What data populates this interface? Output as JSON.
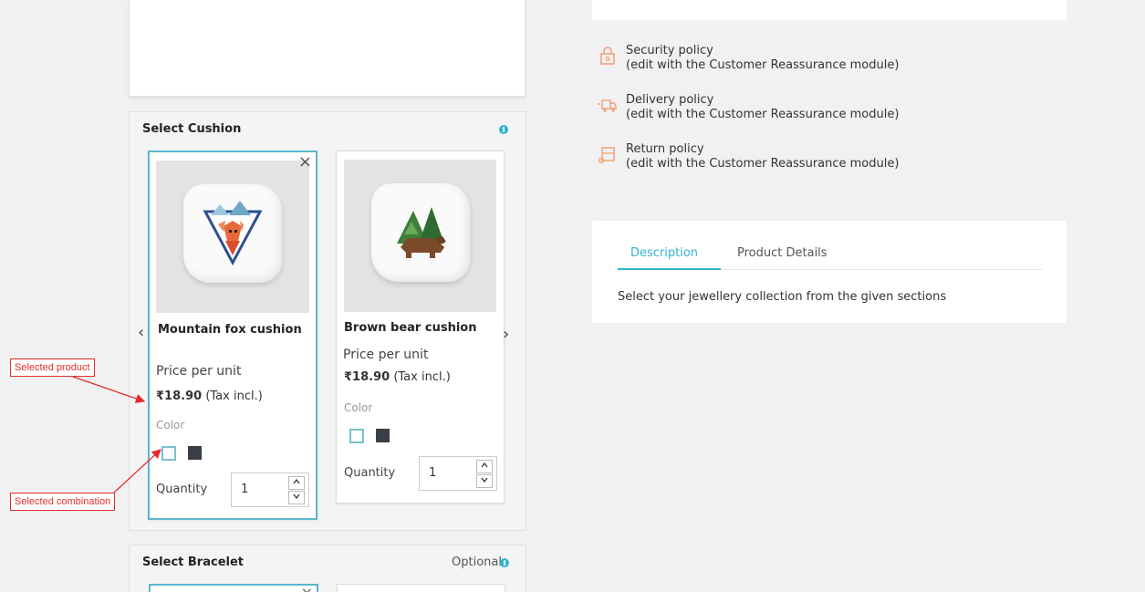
{
  "cushion_section": {
    "title": "Select Cushion",
    "products": [
      {
        "name": "Mountain fox cushion",
        "unit_label": "Price per unit",
        "price": "₹18.90",
        "tax": "(Tax incl.)",
        "color_label": "Color",
        "quantity_label": "Quantity",
        "quantity": "1",
        "remove_symbol": "×"
      },
      {
        "name": "Brown bear cushion",
        "unit_label": "Price per unit",
        "price": "₹18.90",
        "tax": "(Tax incl.)",
        "color_label": "Color",
        "quantity_label": "Quantity",
        "quantity": "1"
      }
    ],
    "prev_arrow": "‹",
    "next_arrow": "›",
    "swatch_colors": [
      "#ffffff",
      "#3a3f47"
    ],
    "stepper_up": "^",
    "stepper_down": "v"
  },
  "bracelet_section": {
    "title": "Select Bracelet",
    "optional_label": "Optional",
    "remove_symbol": "×"
  },
  "annotations": {
    "selected_product": "Selected product",
    "selected_combination": "Selected combination"
  },
  "reassurance": [
    {
      "title": "Security policy",
      "subtitle": "(edit with the Customer Reassurance module)",
      "icon": "lock-icon"
    },
    {
      "title": "Delivery policy",
      "subtitle": "(edit with the Customer Reassurance module)",
      "icon": "truck-icon"
    },
    {
      "title": "Return policy",
      "subtitle": "(edit with the Customer Reassurance module)",
      "icon": "return-box-icon"
    }
  ],
  "tabs": {
    "description": "Description",
    "product_details": "Product Details",
    "description_text": "Select your jewellery collection from the given sections"
  },
  "colors": {
    "accent": "#2fb5d2",
    "annotation": "#e32d2d",
    "reassurance_icon": "#f39d72"
  }
}
